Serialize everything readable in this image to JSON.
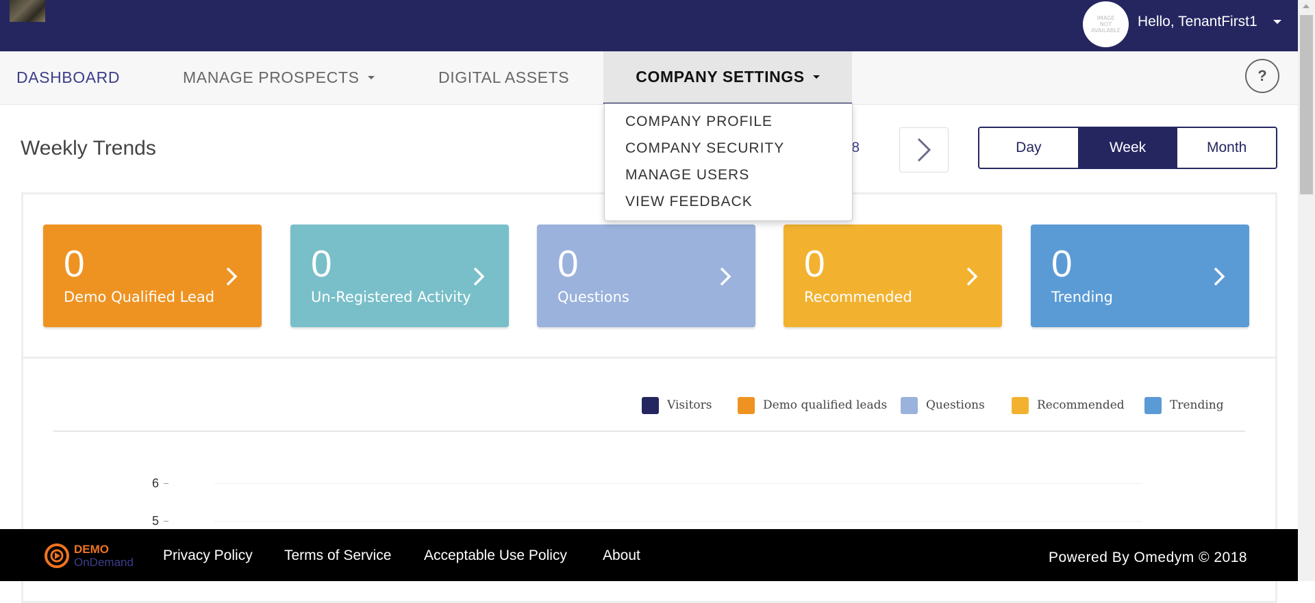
{
  "header": {
    "user_greeting": "Hello, TenantFirst1",
    "avatar_text": "IMAGE NOT AVAILABLE"
  },
  "nav": {
    "dashboard": "DASHBOARD",
    "manage_prospects": "MANAGE PROSPECTS",
    "digital_assets": "DIGITAL ASSETS",
    "company_settings": "COMPANY SETTINGS",
    "help_label": "?"
  },
  "dropdown": {
    "items": [
      "COMPANY PROFILE",
      "COMPANY SECURITY",
      "MANAGE USERS",
      "VIEW FEEDBACK"
    ]
  },
  "page": {
    "title": "Weekly Trends",
    "date_partial": "018",
    "periods": [
      "Day",
      "Week",
      "Month"
    ],
    "active_period": "Week"
  },
  "cards": [
    {
      "count": "0",
      "label": "Demo Qualified Lead",
      "color": "#ee9322"
    },
    {
      "count": "0",
      "label": "Un-Registered Activity",
      "color": "#79bfc9"
    },
    {
      "count": "0",
      "label": "Questions",
      "color": "#9ab2dc"
    },
    {
      "count": "0",
      "label": "Recommended",
      "color": "#f2b230"
    },
    {
      "count": "0",
      "label": "Trending",
      "color": "#5b9bd5"
    }
  ],
  "legend": [
    {
      "label": "Visitors",
      "color": "#252660"
    },
    {
      "label": "Demo qualified leads",
      "color": "#ee9322"
    },
    {
      "label": "Questions",
      "color": "#9ab2dc"
    },
    {
      "label": "Recommended",
      "color": "#f2b230"
    },
    {
      "label": "Trending",
      "color": "#5b9bd5"
    }
  ],
  "chart_data": {
    "type": "line",
    "series": [
      {
        "name": "Visitors",
        "values": []
      },
      {
        "name": "Demo qualified leads",
        "values": []
      },
      {
        "name": "Questions",
        "values": []
      },
      {
        "name": "Recommended",
        "values": []
      },
      {
        "name": "Trending",
        "values": []
      }
    ],
    "y_ticks": [
      6,
      5
    ]
  },
  "footer": {
    "logo_top": "DEMO",
    "logo_bottom": "OnDemand",
    "links": [
      "Privacy Policy",
      "Terms of Service",
      "Acceptable Use Policy",
      "About"
    ],
    "powered_by": "Powered By Omedym © 2018"
  },
  "colors": {
    "primary": "#252660",
    "accent_orange": "#ee9322"
  }
}
